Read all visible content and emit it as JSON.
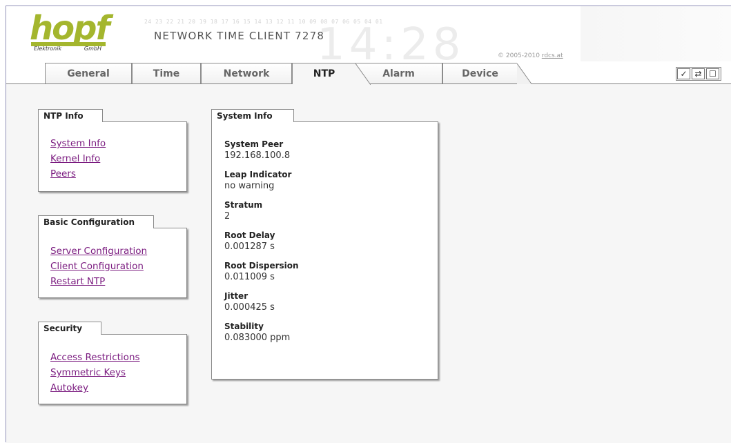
{
  "header": {
    "logo": "hopf",
    "logo_sub_left": "Elektronik",
    "logo_sub_right": "GmbH",
    "tick_numbers": "24 23 22 21 20 19 18 17 16 15 14 13 12 11 10 09 08 07 06 05 04 01",
    "product_title": "NETWORK TIME CLIENT 7278",
    "copyright_text": "© 2005-2010",
    "copyright_link": "rdcs.at"
  },
  "tabs": [
    {
      "label": "General"
    },
    {
      "label": "Time"
    },
    {
      "label": "Network"
    },
    {
      "label": "NTP",
      "active": true
    },
    {
      "label": "Alarm"
    },
    {
      "label": "Device"
    }
  ],
  "toolbar": {
    "apply_icon": "check-icon",
    "reload_icon": "reload-icon",
    "save_icon": "save-icon"
  },
  "sidebar": {
    "ntp_info": {
      "title": "NTP Info",
      "links": [
        "System Info",
        "Kernel Info",
        "Peers"
      ]
    },
    "basic_config": {
      "title": "Basic Configuration",
      "links": [
        "Server Configuration",
        "Client Configuration",
        "Restart NTP"
      ]
    },
    "security": {
      "title": "Security",
      "links": [
        "Access Restrictions",
        "Symmetric Keys",
        "Autokey"
      ]
    }
  },
  "system_info": {
    "title": "System Info",
    "fields": [
      {
        "label": "System Peer",
        "value": "192.168.100.8"
      },
      {
        "label": "Leap Indicator",
        "value": "no warning"
      },
      {
        "label": "Stratum",
        "value": "2"
      },
      {
        "label": "Root Delay",
        "value": "0.001287 s"
      },
      {
        "label": "Root Dispersion",
        "value": "0.011009 s"
      },
      {
        "label": "Jitter",
        "value": "0.000425 s"
      },
      {
        "label": "Stability",
        "value": "0.083000 ppm"
      }
    ]
  },
  "colors": {
    "logo_green": "#a4b62e",
    "link": "#7a1a7f",
    "content_bg": "#f6f6f6"
  }
}
